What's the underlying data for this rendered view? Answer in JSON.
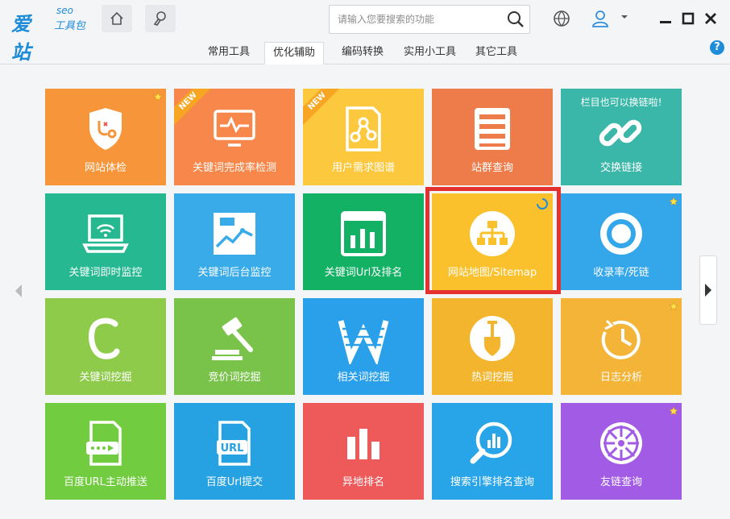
{
  "app": {
    "logo_main": "爱站",
    "logo_seo": "seo",
    "logo_sub": "工具包"
  },
  "search": {
    "placeholder": "请输入您要搜索的功能"
  },
  "tabs": [
    {
      "label": "常用工具",
      "active": false
    },
    {
      "label": "优化辅助",
      "active": true
    },
    {
      "label": "编码转换",
      "active": false
    },
    {
      "label": "实用小工具",
      "active": false
    },
    {
      "label": "其它工具",
      "active": false
    }
  ],
  "help_label": "?",
  "tiles": [
    {
      "label": "网站体检",
      "color": "#f7953a",
      "icon": "shield-stethoscope-icon",
      "star": true
    },
    {
      "label": "关键词完成率检测",
      "color": "#f7874a",
      "icon": "monitor-pulse-icon",
      "ribbon": "NEW"
    },
    {
      "label": "用户需求图谱",
      "color": "#fcc93e",
      "icon": "mind-map-icon",
      "ribbon": "NEW"
    },
    {
      "label": "站群查询",
      "color": "#ee7c4a",
      "icon": "list-icon"
    },
    {
      "label": "交换链接",
      "color": "#3ab7a8",
      "icon": "chain-link-icon",
      "top_text": "栏目也可以换链啦!"
    },
    {
      "label": "关键词即时监控",
      "color": "#25b891",
      "icon": "laptop-wifi-icon"
    },
    {
      "label": "关键词后台监控",
      "color": "#39abe9",
      "icon": "chart-monitor-icon"
    },
    {
      "label": "关键词Url及排名",
      "color": "#13b164",
      "icon": "bar-chart-icon"
    },
    {
      "label": "网站地图/Sitemap",
      "color": "#fbc12c",
      "icon": "sitemap-icon",
      "spinner": true
    },
    {
      "label": "收录率/死链",
      "color": "#34a6ea",
      "icon": "ring-icon",
      "star": true
    },
    {
      "label": "关键词挖掘",
      "color": "#8fcb4b",
      "icon": "letter-c-icon"
    },
    {
      "label": "竞价词挖掘",
      "color": "#7ac34a",
      "icon": "gavel-icon"
    },
    {
      "label": "相关词挖掘",
      "color": "#2a9fea",
      "icon": "letter-w-icon"
    },
    {
      "label": "热词挖掘",
      "color": "#f4b52e",
      "icon": "shovel-icon"
    },
    {
      "label": "日志分析",
      "color": "#f3b438",
      "icon": "clock-icon",
      "star": true
    },
    {
      "label": "百度URL主动推送",
      "color": "#71cc3f",
      "icon": "url-push-icon"
    },
    {
      "label": "百度Url提交",
      "color": "#26a1e1",
      "icon": "url-doc-icon"
    },
    {
      "label": "异地排名",
      "color": "#ee5a5a",
      "icon": "bar-chart-icon"
    },
    {
      "label": "搜索引擎排名查询",
      "color": "#28a4e8",
      "icon": "magnifier-chart-icon"
    },
    {
      "label": "友链查询",
      "color": "#a25be4",
      "icon": "wheel-icon",
      "star": true
    }
  ]
}
